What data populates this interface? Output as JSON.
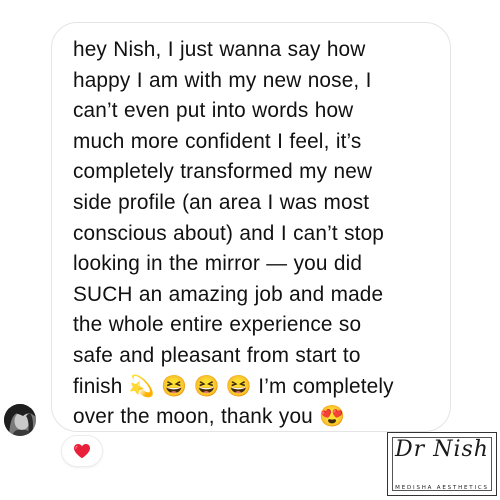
{
  "message": {
    "text": "hey Nish, I just wanna say how\nhappy I am with my new nose, I\ncan’t even put into words how\nmuch more confident I feel, it’s\ncompletely transformed my new\nside profile (an area I was most\nconscious about) and I can’t stop\nlooking in the mirror — you did\nSUCH an amazing job and made\nthe whole entire experience so\nsafe and pleasant from start to\nfinish 💫 😆 😆 😆  I’m completely\nover the moon, thank you 😍"
  },
  "sender": {
    "avatar_icon": "profile-photo"
  },
  "reaction": {
    "emoji_icon": "red-heart-icon",
    "color": "#e8203a"
  },
  "watermark": {
    "script_text": "Dr Nish",
    "subtitle": "MEDISHA AESTHETICS"
  },
  "colors": {
    "bubble_border": "#e4e4e4",
    "text": "#111111",
    "heart": "#e8203a"
  }
}
